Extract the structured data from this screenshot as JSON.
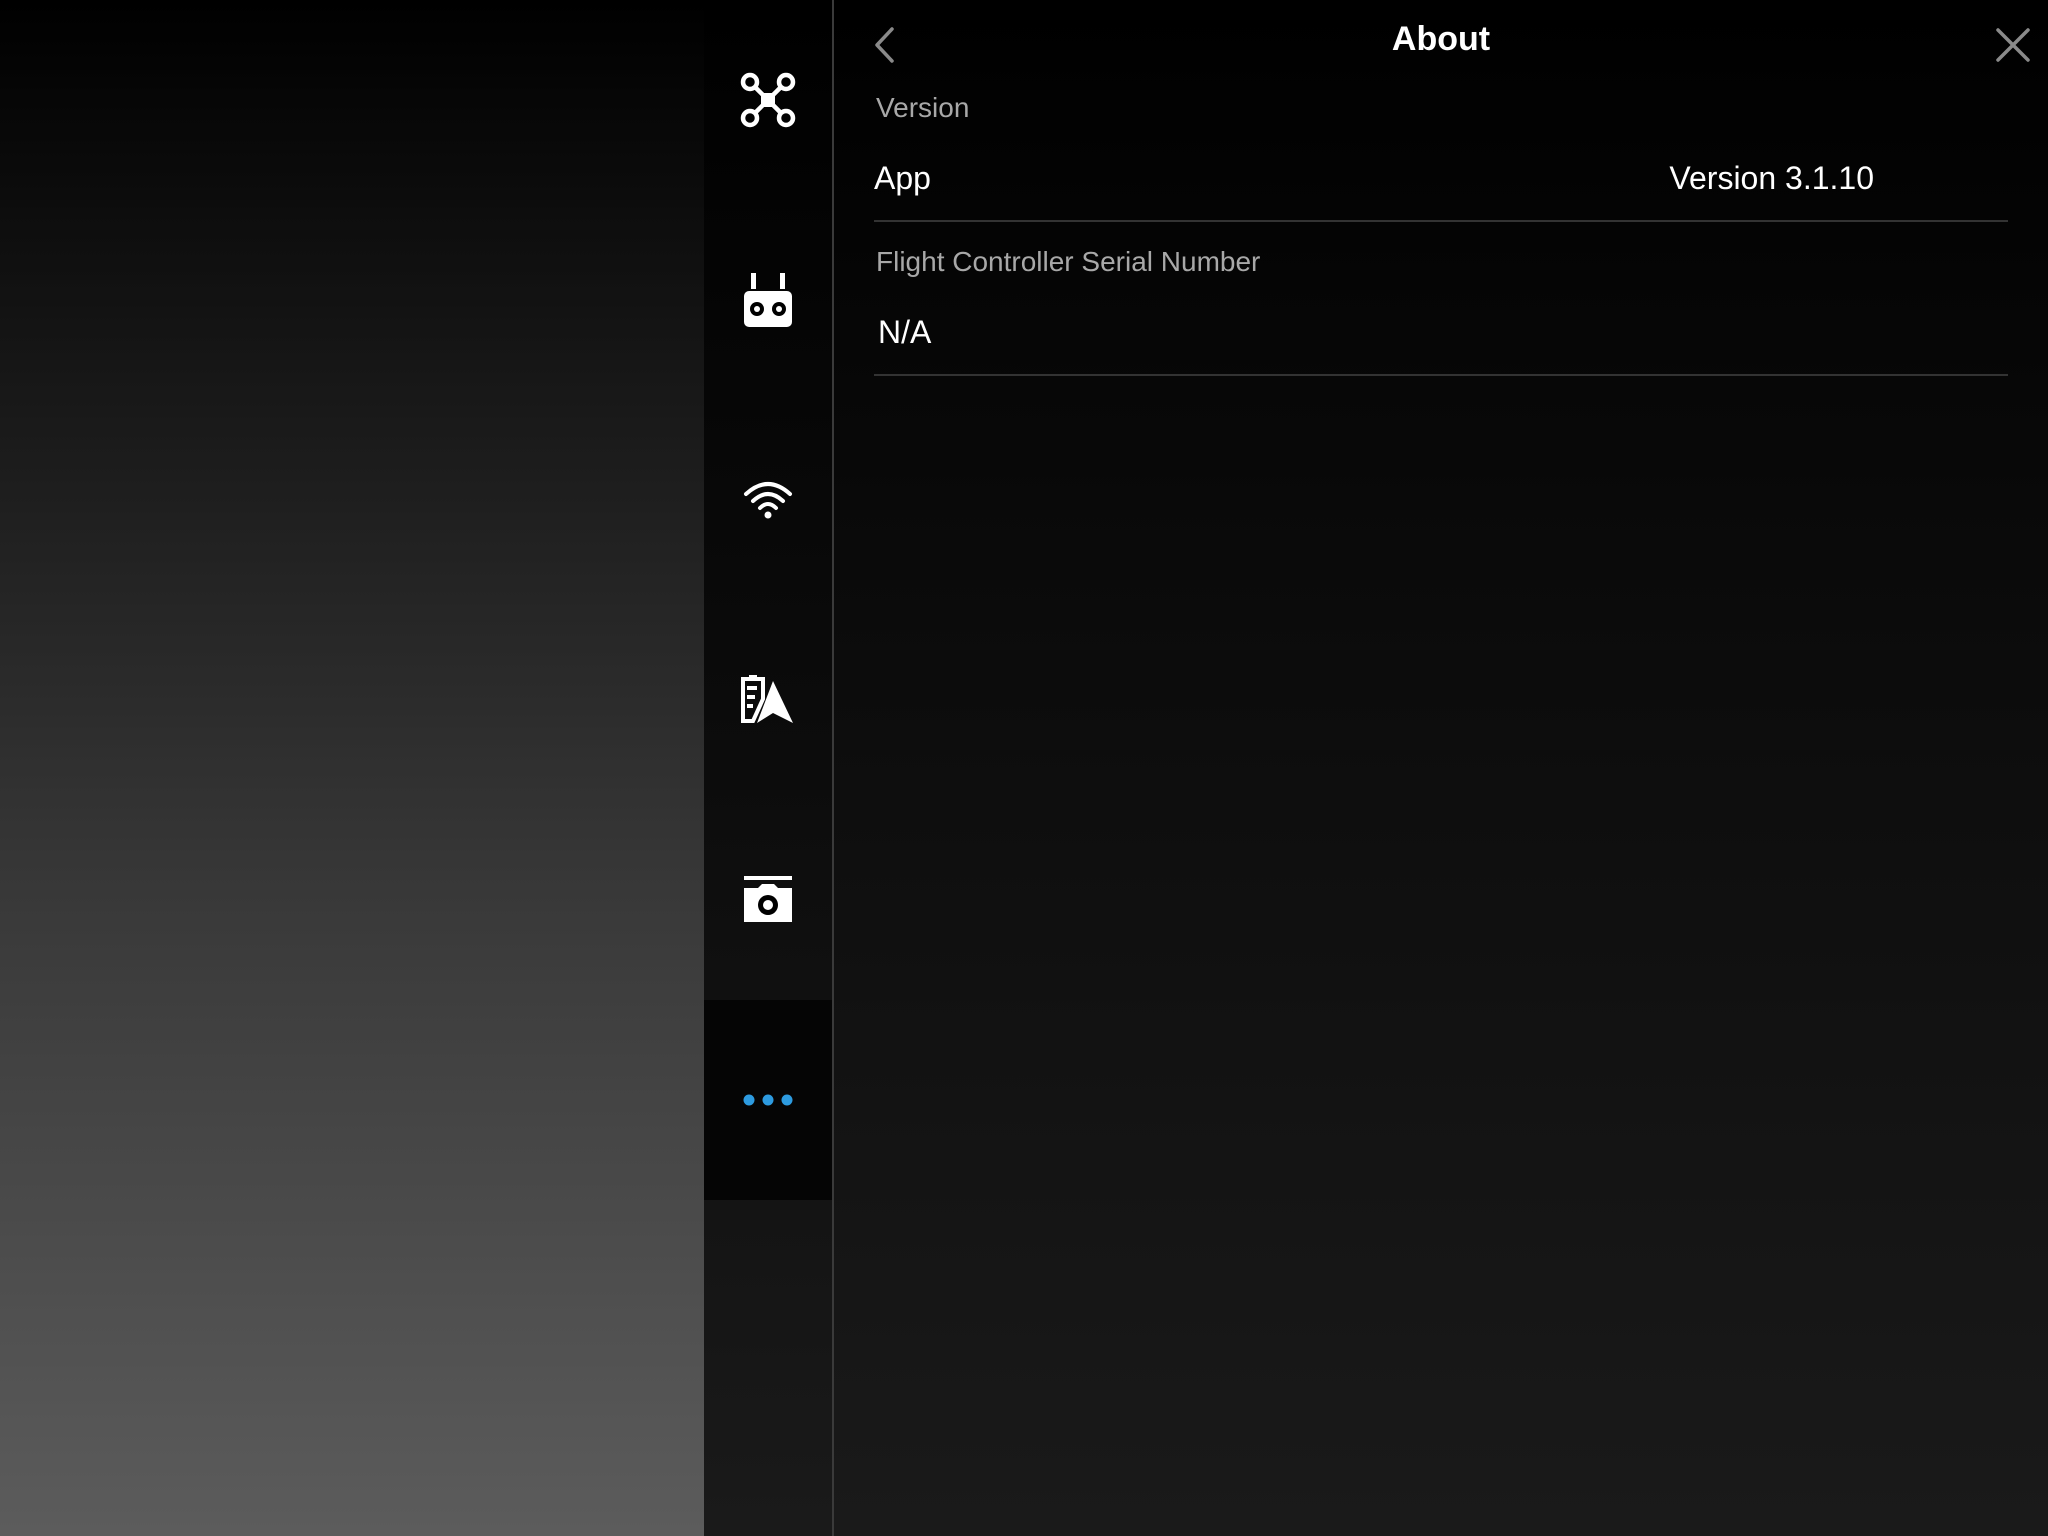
{
  "header": {
    "title": "About"
  },
  "sidebar": {
    "items": [
      {
        "icon": "drone-icon"
      },
      {
        "icon": "remote-controller-icon"
      },
      {
        "icon": "wifi-icon"
      },
      {
        "icon": "battery-navigation-icon"
      },
      {
        "icon": "camera-icon"
      },
      {
        "icon": "more-icon",
        "active": true
      }
    ]
  },
  "sections": {
    "version": {
      "label": "Version",
      "row_label": "App",
      "row_value": "Version 3.1.10"
    },
    "serial": {
      "label": "Flight Controller Serial Number",
      "row_label": "N/A"
    }
  },
  "colors": {
    "accent": "#2d9be0",
    "text": "#ffffff",
    "muted": "#a8a8a8",
    "divider": "#333333"
  }
}
